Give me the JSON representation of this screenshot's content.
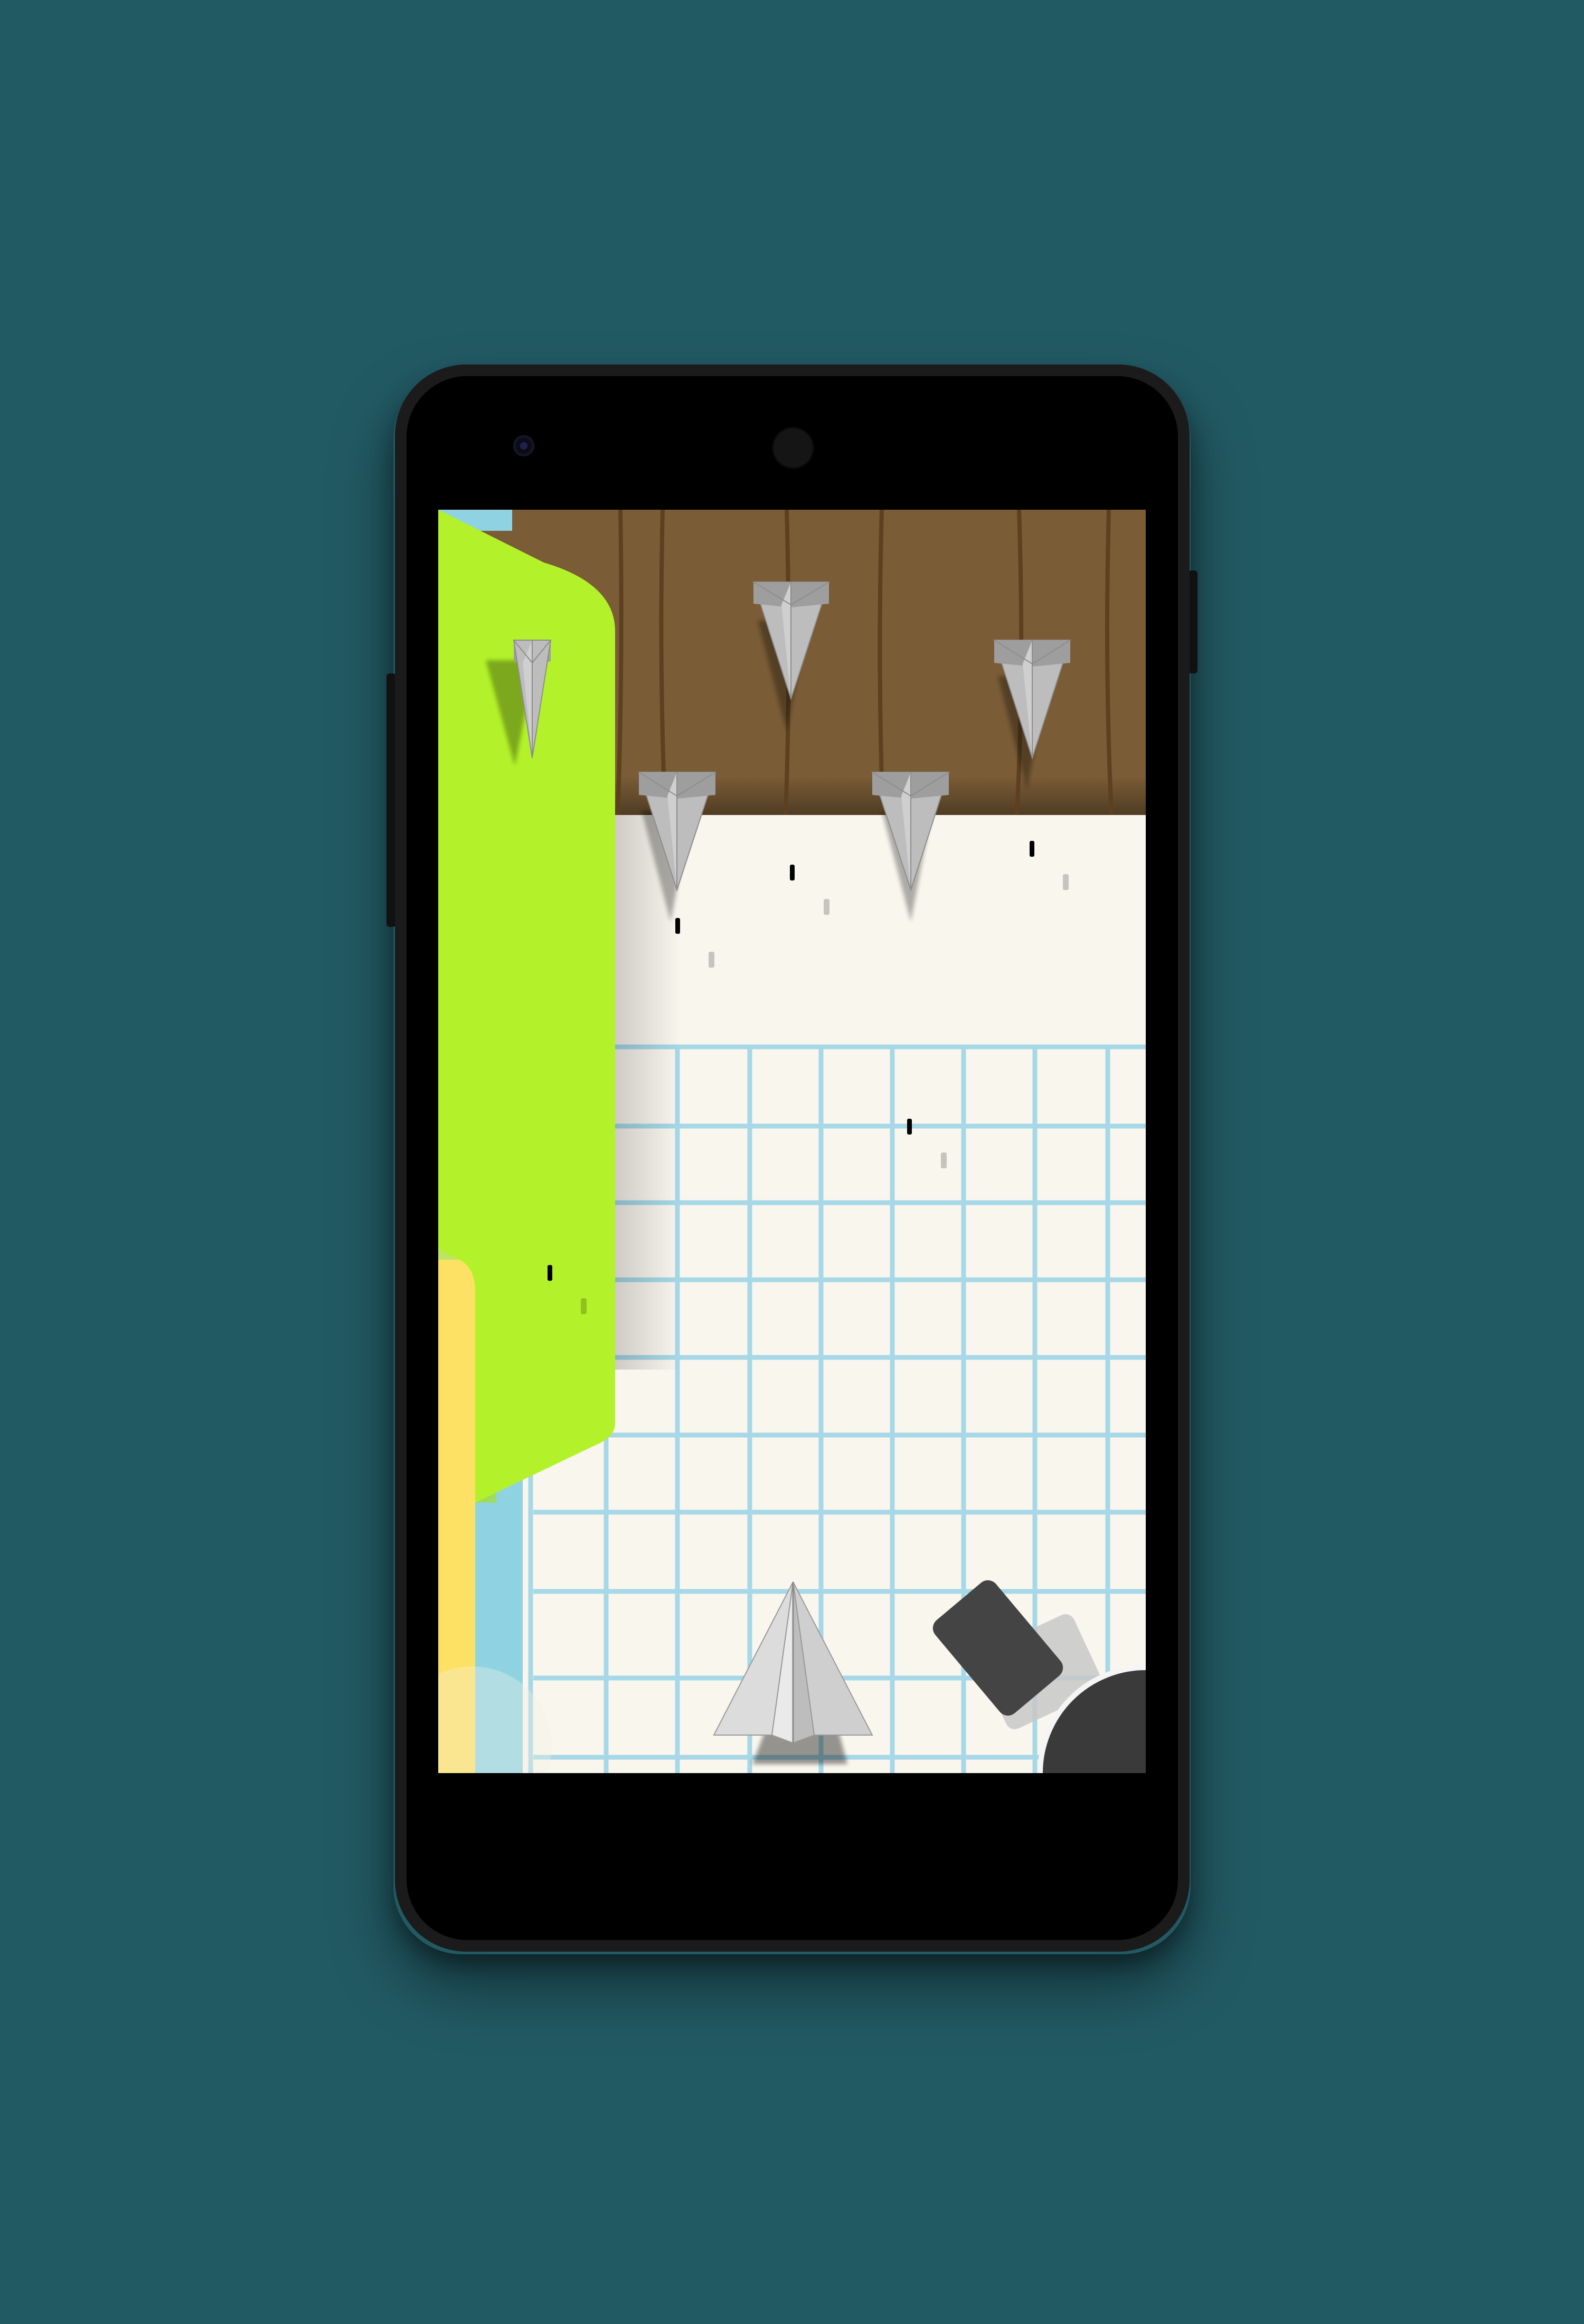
{
  "device": {
    "model": "smartphone",
    "background_color": "#225a64",
    "body_color": "#1b1b1b"
  },
  "game": {
    "player": {
      "type": "paper-plane",
      "color": "#e6e6e6"
    },
    "enemies": {
      "type": "paper-plane",
      "count": 5,
      "color": "#b3b3b3"
    },
    "projectiles": {
      "count": 6
    },
    "colors": {
      "wood_table": "#7a5c36",
      "paper": "#f9f6ee",
      "grid_lines": "#a6d8e8",
      "green_folder": "#b3f22a",
      "yellow_folder": "#fde165",
      "cannon": "#3a3a3a"
    },
    "icons": [
      "paper-plane-player-icon",
      "paper-plane-enemy-icon",
      "cannon-icon",
      "projectile-icon"
    ]
  }
}
